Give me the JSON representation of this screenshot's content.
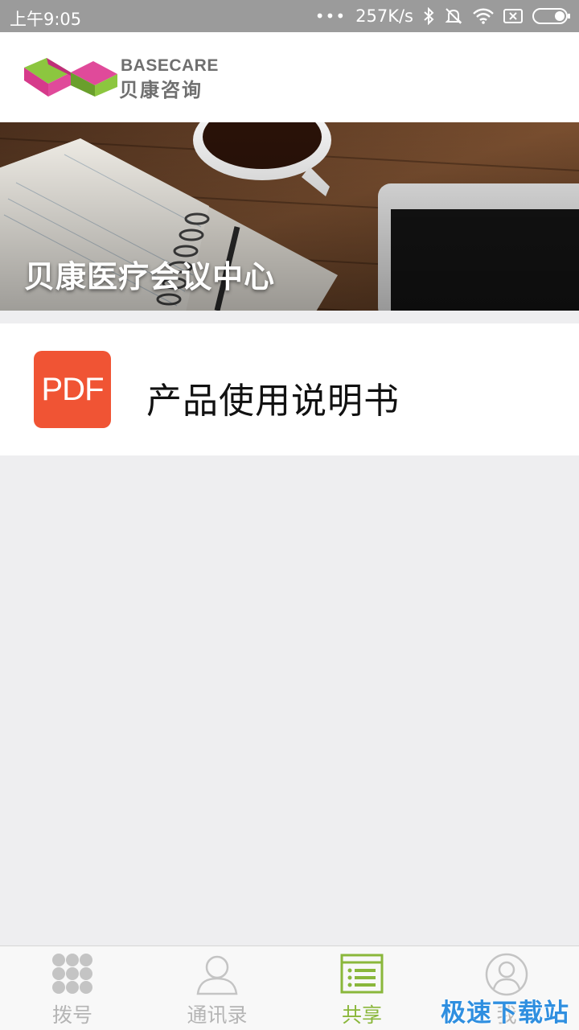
{
  "status_bar": {
    "time": "上午9:05",
    "dots": "•••",
    "speed": "257K/s"
  },
  "header": {
    "logo_en": "BASECARE",
    "logo_cn": "贝康咨询"
  },
  "banner": {
    "title": "贝康医疗会议中心"
  },
  "documents": [
    {
      "icon_text": "PDF",
      "title": "产品使用说明书"
    }
  ],
  "nav": {
    "items": [
      {
        "label": "拨号",
        "icon": "dialpad-icon"
      },
      {
        "label": "通讯录",
        "icon": "contacts-icon"
      },
      {
        "label": "共享",
        "icon": "share-list-icon",
        "active": true
      },
      {
        "label": "我",
        "icon": "profile-icon"
      }
    ]
  },
  "watermark": "极速下载站",
  "colors": {
    "accent": "#8ab73b",
    "pdf": "#f05434",
    "status_bar": "#9b9b9b"
  }
}
